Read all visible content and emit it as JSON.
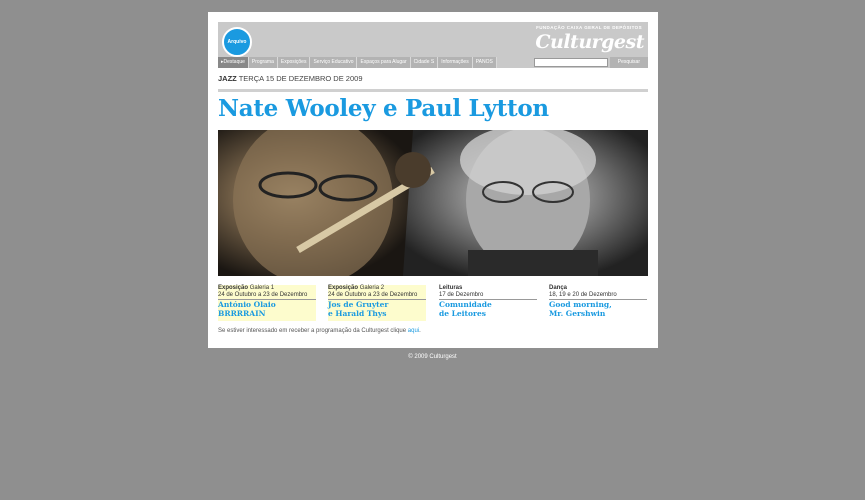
{
  "header": {
    "archive_label": "Arquivo",
    "foundation_label": "FUNDAÇÃO CAIXA GERAL DE DEPÓSITOS",
    "logo": "Culturgest"
  },
  "nav": {
    "items": [
      "Destaque",
      "Programa",
      "Exposições",
      "Serviço Educativo",
      "Espaços para Alugar",
      "Cidade S",
      "Informações",
      "PANOS"
    ],
    "search_placeholder": "",
    "search_button": "Pesquisar"
  },
  "event": {
    "category": "JAZZ",
    "date": "TERÇA 15 DE DEZEMBRO DE 2009",
    "title": "Nate Wooley e Paul Lytton"
  },
  "columns": [
    {
      "cat": "Exposição",
      "sub": "Galeria 1",
      "dates": "24 de Outubro a 23 de Dezembro",
      "line1": "António Olaio",
      "line2": "BRRRRAIN",
      "highlight": true
    },
    {
      "cat": "Exposição",
      "sub": "Galeria 2",
      "dates": "24 de Outubro a 23 de Dezembro",
      "line1": "Jos de Gruyter",
      "line2": "e Harald Thys",
      "highlight": true
    },
    {
      "cat": "Leituras",
      "sub": "",
      "dates": "17 de Dezembro",
      "line1": "Comunidade",
      "line2": "de Leitores",
      "highlight": false
    },
    {
      "cat": "Dança",
      "sub": "",
      "dates": "18, 19 e 20 de Dezembro",
      "line1": "Good morning,",
      "line2": "Mr. Gershwin",
      "highlight": false
    }
  ],
  "note": {
    "text": "Se estiver interessado em receber a programação da Culturgest clique",
    "link": "aqui"
  },
  "footer": "© 2009 Culturgest"
}
